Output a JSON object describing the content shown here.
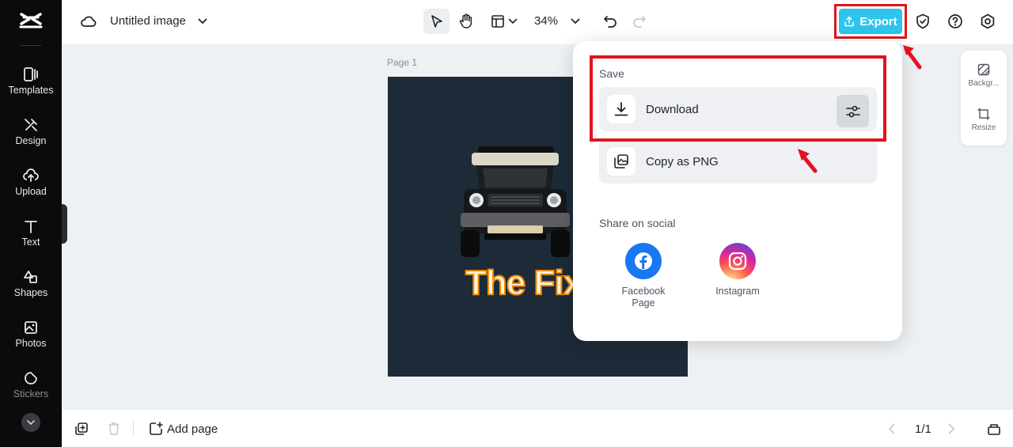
{
  "sidebar": {
    "items": [
      {
        "label": "Templates",
        "icon": "templates-icon"
      },
      {
        "label": "Design",
        "icon": "design-icon"
      },
      {
        "label": "Upload",
        "icon": "upload-icon"
      },
      {
        "label": "Text",
        "icon": "text-icon"
      },
      {
        "label": "Shapes",
        "icon": "shapes-icon"
      },
      {
        "label": "Photos",
        "icon": "photos-icon"
      },
      {
        "label": "Stickers",
        "icon": "stickers-icon"
      }
    ]
  },
  "topbar": {
    "title": "Untitled image",
    "zoom": "34%",
    "export_label": "Export"
  },
  "canvas": {
    "page_label": "Page 1",
    "artwork_text": "The Fixe"
  },
  "right_panel": {
    "items": [
      {
        "label": "Backgr..."
      },
      {
        "label": "Resize"
      }
    ]
  },
  "export_menu": {
    "save_label": "Save",
    "download_label": "Download",
    "copy_label": "Copy as PNG",
    "share_label": "Share on social",
    "socials": [
      {
        "label": "Facebook Page",
        "color": "#1877f2"
      },
      {
        "label": "Instagram",
        "color": "#d6249f"
      }
    ]
  },
  "bottombar": {
    "add_page_label": "Add page",
    "page_count": "1/1"
  },
  "colors": {
    "accent": "#2fc4ee",
    "highlight": "#e1141e",
    "sidebar_bg": "#0b0b0c",
    "artboard_bg": "#1d2b38"
  }
}
